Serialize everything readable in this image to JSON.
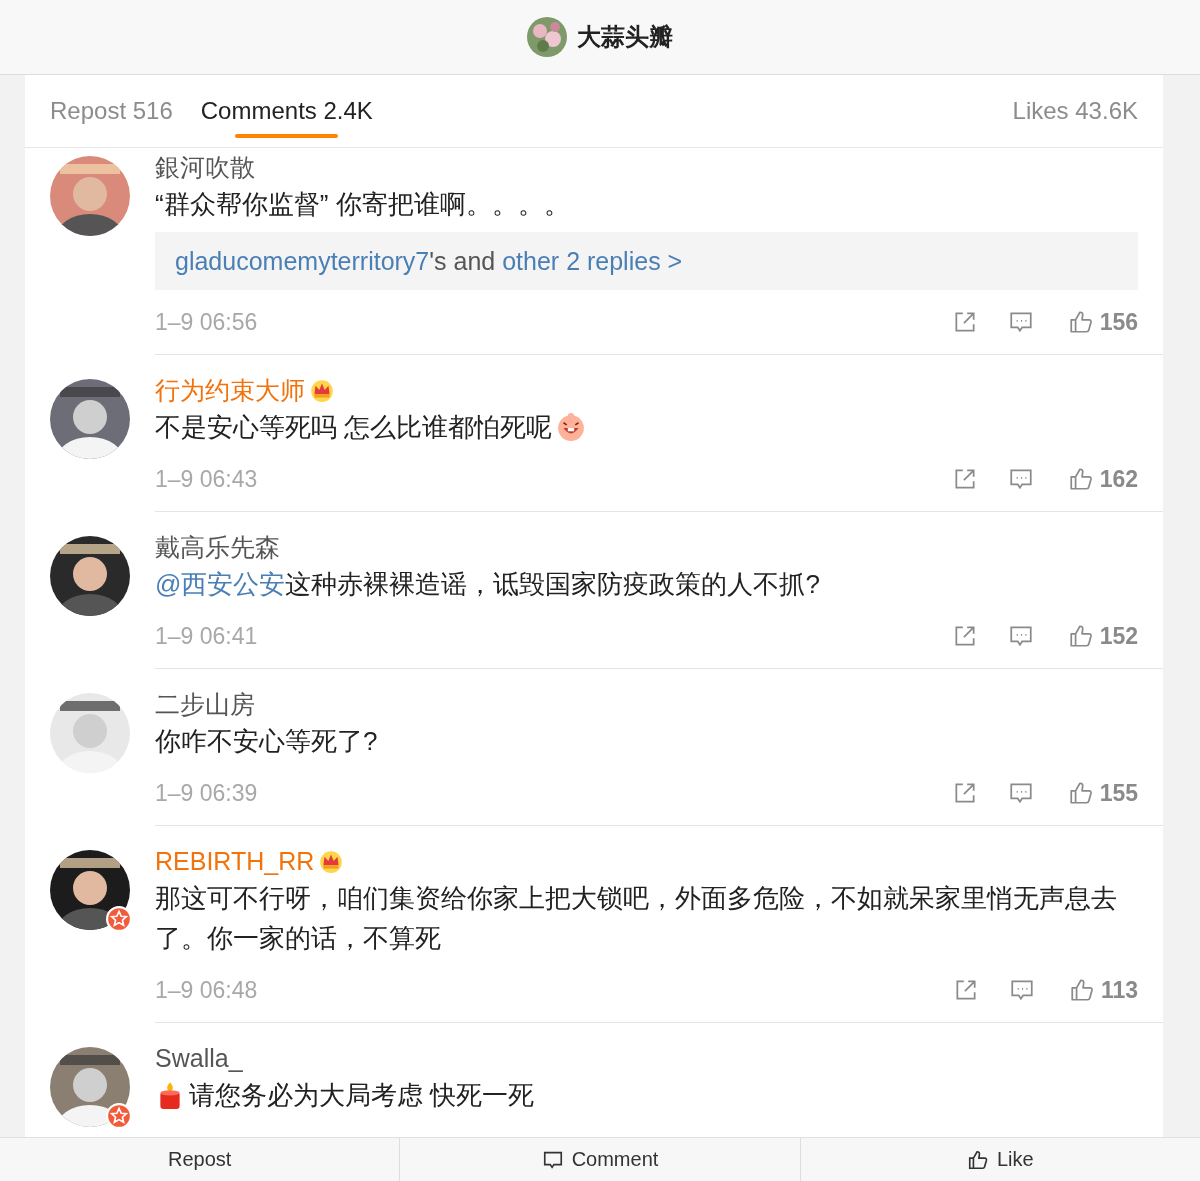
{
  "header": {
    "title": "大蒜头瓣"
  },
  "tabs": [
    {
      "label": "Repost 516",
      "selected": false
    },
    {
      "label": "Comments 2.4K",
      "selected": true
    },
    {
      "label": "Likes 43.6K",
      "selected": false
    }
  ],
  "comments": [
    {
      "name": "銀河吹散",
      "vip": false,
      "verified": false,
      "start_emoji": false,
      "end_emoji": false,
      "text": "“群众帮你监督” 你寄把谁啊。。。。",
      "replies": {
        "user": "gladucomemyterritory7",
        "joiner": "'s and",
        "more": "other 2 replies >"
      },
      "time": "1–9 06:56",
      "likes": "156"
    },
    {
      "name": "行为约束大师",
      "vip": true,
      "verified": false,
      "start_emoji": false,
      "end_emoji": true,
      "text": "不是安心等死吗 怎么比谁都怕死呢",
      "time": "1–9 06:43",
      "likes": "162"
    },
    {
      "name": "戴高乐先森",
      "vip": false,
      "verified": false,
      "start_emoji": false,
      "end_emoji": false,
      "mention": "@西安公安",
      "text": "这种赤裸裸造谣，诋毁国家防疫政策的人不抓?",
      "time": "1–9 06:41",
      "likes": "152"
    },
    {
      "name": "二步山房",
      "vip": false,
      "verified": false,
      "start_emoji": false,
      "end_emoji": false,
      "text": "你咋不安心等死了?",
      "time": "1–9 06:39",
      "likes": "155"
    },
    {
      "name": "REBIRTH_RR",
      "vip": true,
      "verified": true,
      "start_emoji": false,
      "end_emoji": false,
      "text": "那这可不行呀，咱们集资给你家上把大锁吧，外面多危险，不如就呆家里悄无声息去了。你一家的话，不算死",
      "time": "1–9 06:48",
      "likes": "113"
    },
    {
      "name": "Swalla_",
      "vip": false,
      "verified": true,
      "start_emoji": true,
      "end_emoji": false,
      "text": "请您务必为大局考虑 快死一死"
    }
  ],
  "bottom_bar": [
    {
      "kind": "repost",
      "label": "Repost"
    },
    {
      "kind": "comment",
      "label": "Comment"
    },
    {
      "kind": "like",
      "label": "Like"
    }
  ]
}
